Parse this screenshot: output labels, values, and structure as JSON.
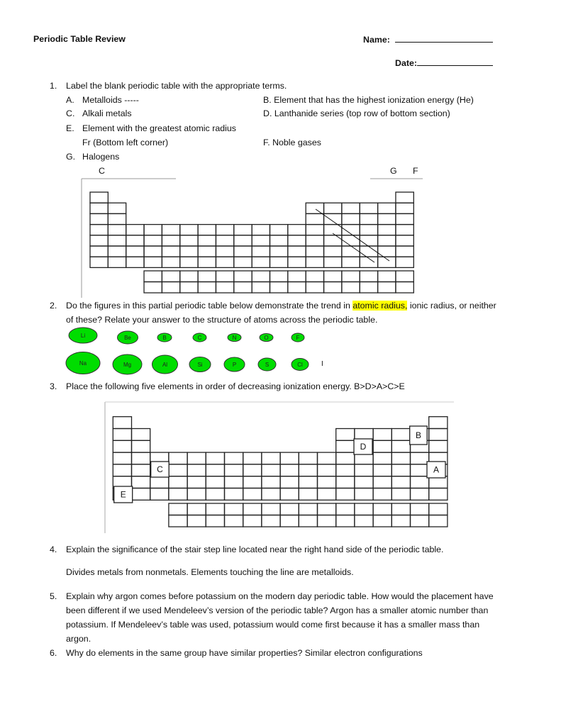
{
  "header": {
    "title": "Periodic Table Review",
    "name_label": "Name:",
    "date_label": "Date:"
  },
  "q1": {
    "number": "1.",
    "prompt": "Label the blank periodic table with the appropriate terms.",
    "items": {
      "a": {
        "letter": "A.",
        "text": "Metalloids  -----"
      },
      "b": {
        "text": "B. Element that has the highest ionization energy  (He)"
      },
      "c": {
        "letter": "C.",
        "text": "Alkali metals"
      },
      "d": {
        "text": "D. Lanthanide series (top row of bottom section)"
      },
      "e": {
        "letter": "E.",
        "text": "Element with the greatest atomic radius"
      },
      "e_answer": "Fr  (Bottom left corner)",
      "f": {
        "text": "F. Noble gases"
      },
      "g": {
        "letter": "G.",
        "text": "Halogens"
      }
    },
    "table_labels": {
      "c": "C",
      "g": "G",
      "f": "F"
    }
  },
  "q2": {
    "number": "2.",
    "line1_before": "Do the figures in this partial periodic table below demonstrate the trend in ",
    "line1_highlight": "atomic radius,",
    "line1_after": " ionic radius, or neither",
    "line2": "of these?  Relate your answer to the structure of atoms across the periodic table.",
    "highlight_color": "#ffff00",
    "circle_color": "#00dd00",
    "row1": [
      "Li",
      "Be",
      "B",
      "C",
      "N",
      "O",
      "F"
    ],
    "row2": [
      "Na",
      "Mg",
      "Al",
      "Si",
      "P",
      "S",
      "Cl"
    ],
    "trailing_mark": "I"
  },
  "q3": {
    "number": "3.",
    "prompt": "Place the following five elements in order of decreasing ionization energy.  B>D>A>C>E",
    "box_labels": {
      "a": "A",
      "b": "B",
      "c": "C",
      "d": "D",
      "e": "E"
    }
  },
  "q4": {
    "number": "4.",
    "prompt": "Explain the significance of the stair step line located near the right hand side of the periodic table.",
    "answer": "Divides metals from nonmetals.  Elements touching the line are metalloids."
  },
  "q5": {
    "number": "5.",
    "lines": [
      "Explain why argon comes before potassium on the modern day periodic table.  How would the placement have",
      "been different if we used Mendeleev’s version of the periodic table? Argon has a smaller atomic number than",
      "potassium.  If Mendeleev’s table was used, potassium would come first because it has a smaller mass than",
      "argon."
    ]
  },
  "q6": {
    "number": "6.",
    "prompt": "Why do elements in the same group have similar properties?  Similar electron configurations"
  }
}
